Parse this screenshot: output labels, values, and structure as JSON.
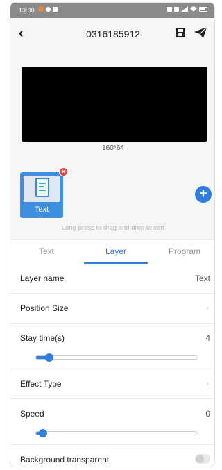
{
  "status_bar": {
    "time": "13:00"
  },
  "header": {
    "title": "0316185912"
  },
  "preview": {
    "size_label": "160*64"
  },
  "program_list": {
    "items": [
      {
        "label": "Text"
      }
    ],
    "hint": "Long press to drag and drop to sort"
  },
  "tabs": [
    {
      "label": "Text"
    },
    {
      "label": "Layer",
      "active": true
    },
    {
      "label": "Program"
    }
  ],
  "settings": {
    "layer_name": {
      "label": "Layer name",
      "value": "Text"
    },
    "position_size": {
      "label": "Position Size"
    },
    "stay_time": {
      "label": "Stay time(s)",
      "value": "4",
      "slider_fraction": 0.04
    },
    "effect_type": {
      "label": "Effect Type"
    },
    "speed": {
      "label": "Speed",
      "value": "0",
      "slider_fraction": 0.0
    },
    "background_transparent": {
      "label": "Background transparent",
      "on": false
    }
  },
  "colors": {
    "accent": "#2f7de0",
    "tile": "#3f8fe0",
    "delete_badge": "#e04a4a"
  },
  "icons": [
    "back-arrow-icon",
    "save-icon",
    "send-icon",
    "document-icon",
    "close-icon",
    "add-icon",
    "chevron-right-icon"
  ]
}
